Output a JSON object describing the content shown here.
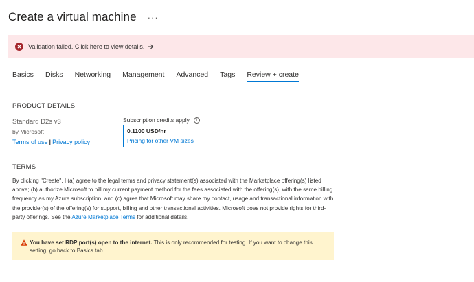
{
  "header": {
    "title": "Create a virtual machine",
    "more_label": "···"
  },
  "banner": {
    "text": "Validation failed. Click here to view details.",
    "arrow": "→",
    "icon": "error-icon",
    "color": "#fde7e9"
  },
  "tabs": [
    {
      "label": "Basics",
      "active": false
    },
    {
      "label": "Disks",
      "active": false
    },
    {
      "label": "Networking",
      "active": false
    },
    {
      "label": "Management",
      "active": false
    },
    {
      "label": "Advanced",
      "active": false
    },
    {
      "label": "Tags",
      "active": false
    },
    {
      "label": "Review + create",
      "active": true
    }
  ],
  "product": {
    "heading": "PRODUCT DETAILS",
    "name": "Standard D2s v3",
    "by": "by Microsoft",
    "terms_link": "Terms of use",
    "separator": "|",
    "privacy_link": "Privacy policy",
    "credits_label": "Subscription credits apply",
    "info_icon": "i",
    "price": "0.1100 USD/hr",
    "pricing_link": "Pricing for other VM sizes"
  },
  "terms": {
    "heading": "TERMS",
    "body_pre": "By clicking \"Create\", I (a) agree to the legal terms and privacy statement(s) associated with the Marketplace offering(s) listed above; (b) authorize Microsoft to bill my current payment method for the fees associated with the offering(s), with the same billing frequency as my Azure subscription; and (c) agree that Microsoft may share my contact, usage and transactional information with the provider(s) of the offering(s) for support, billing and other transactional activities. Microsoft does not provide rights for third-party offerings. See the ",
    "link": "Azure Marketplace Terms",
    "body_post": " for additional details."
  },
  "warning": {
    "title": "You have set RDP port(s) open to the internet.",
    "body": "  This is only recommended for testing.  If you want to change this setting, go back to Basics tab.",
    "icon": "warning-icon",
    "color": "#fff4ce"
  },
  "colors": {
    "accent": "#0078d4",
    "error": "#a4262c",
    "warning_icon": "#d83b01"
  }
}
